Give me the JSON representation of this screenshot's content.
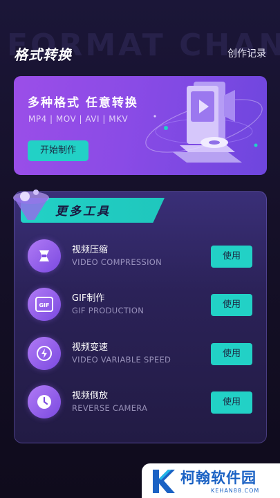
{
  "watermark_text": "FORMAT CHAN",
  "header": {
    "title": "格式转换",
    "history_label": "创作记录"
  },
  "banner": {
    "title": "多种格式 任意转换",
    "formats": "MP4 | MOV | AVI | MKV",
    "start_label": "开始制作"
  },
  "tools": {
    "title": "更多工具",
    "items": [
      {
        "name": "视频压缩",
        "sub": "VIDEO COMPRESSION",
        "button": "使用",
        "icon": "compress-icon"
      },
      {
        "name": "GIF制作",
        "sub": "GIF PRODUCTION",
        "button": "使用",
        "icon": "gif-icon"
      },
      {
        "name": "视频变速",
        "sub": "VIDEO VARIABLE SPEED",
        "button": "使用",
        "icon": "lightning-icon"
      },
      {
        "name": "视频倒放",
        "sub": "REVERSE CAMERA",
        "button": "使用",
        "icon": "clock-icon"
      }
    ]
  },
  "site_logo": {
    "text": "柯翰软件园",
    "url": "KEHAN88.COM"
  },
  "colors": {
    "accent": "#22d1c6",
    "banner_purple": "#8a4be6",
    "background": "#151028"
  }
}
